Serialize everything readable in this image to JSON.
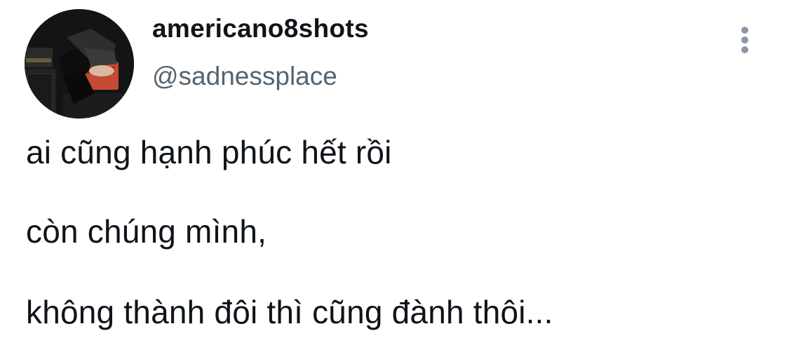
{
  "author": {
    "display_name": "americano8shots",
    "handle": "@sadnessplace"
  },
  "tweet": {
    "lines": [
      "ai cũng hạnh phúc hết rồi",
      "còn chúng mình,",
      "không thành đôi thì cũng đành thôi..."
    ]
  },
  "icons": {
    "more": "more-vertical-icon",
    "avatar": "profile-photo"
  },
  "colors": {
    "text": "#0f1419",
    "secondary_text": "#536471",
    "more_icon": "#8b98a5",
    "background": "#ffffff"
  }
}
